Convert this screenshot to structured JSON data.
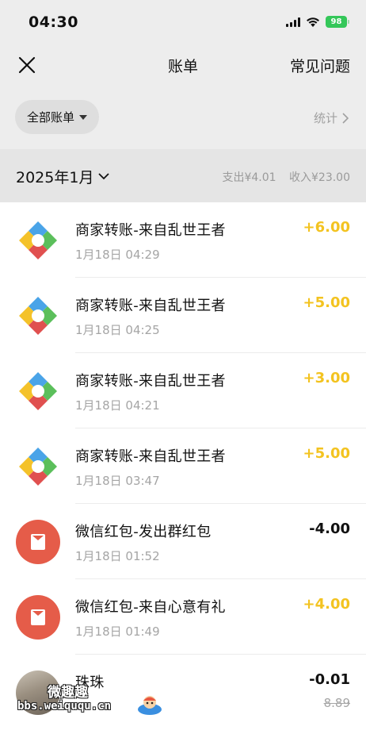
{
  "status_bar": {
    "time": "04:30",
    "battery": "98"
  },
  "nav": {
    "title": "账单",
    "faq": "常见问题"
  },
  "filter": {
    "label": "全部账单",
    "stats": "统计"
  },
  "month": {
    "label": "2025年1月",
    "expense": "支出¥4.01",
    "income": "收入¥23.00"
  },
  "transactions": [
    {
      "icon": "merchant-logo-icon",
      "title": "商家转账-来自乱世王者",
      "time": "1月18日 04:29",
      "amount": "+6.00",
      "kind": "income"
    },
    {
      "icon": "merchant-logo-icon",
      "title": "商家转账-来自乱世王者",
      "time": "1月18日 04:25",
      "amount": "+5.00",
      "kind": "income"
    },
    {
      "icon": "merchant-logo-icon",
      "title": "商家转账-来自乱世王者",
      "time": "1月18日 04:21",
      "amount": "+3.00",
      "kind": "income"
    },
    {
      "icon": "merchant-logo-icon",
      "title": "商家转账-来自乱世王者",
      "time": "1月18日 03:47",
      "amount": "+5.00",
      "kind": "income"
    },
    {
      "icon": "red-packet-icon",
      "title": "微信红包-发出群红包",
      "time": "1月18日 01:52",
      "amount": "-4.00",
      "kind": "expense"
    },
    {
      "icon": "red-packet-icon",
      "title": "微信红包-来自心意有礼",
      "time": "1月18日 01:49",
      "amount": "+4.00",
      "kind": "income"
    },
    {
      "icon": "avatar",
      "title": "珠珠",
      "time": "",
      "amount": "-0.01",
      "sub_amount": "8.89",
      "kind": "expense"
    }
  ],
  "watermark": {
    "line1": "微趣趣",
    "line2": "bbs.weiququ.cn"
  },
  "colors": {
    "income": "#f3c320",
    "expense": "#111111",
    "red_packet": "#e55c49",
    "battery": "#34c759"
  }
}
